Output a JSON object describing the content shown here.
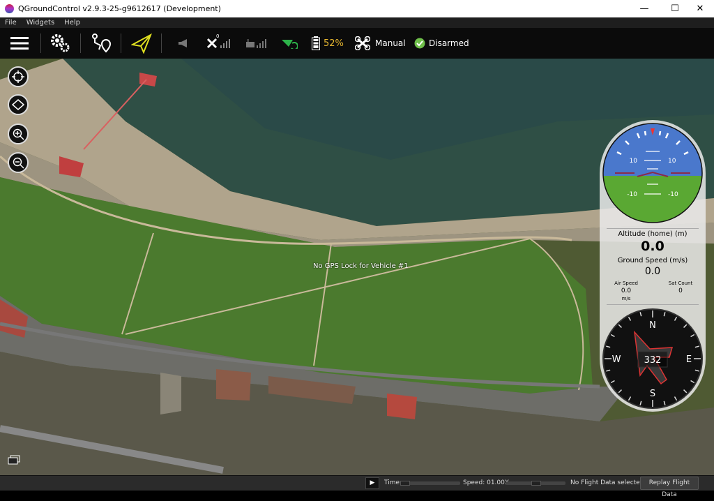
{
  "window": {
    "title": "QGroundControl v2.9.3-25-g9612617 (Development)",
    "minimize": "—",
    "maximize": "☐",
    "close": "✕"
  },
  "menu": [
    "File",
    "Widgets",
    "Help"
  ],
  "toolbar": {
    "battery": "52%",
    "flight_mode": "Manual",
    "arm_status": "Disarmed",
    "gps_sat_count": "0",
    "colors": {
      "battery": "#e8b830",
      "plan_active": "#e0e020",
      "rc_ok": "#2db34a"
    }
  },
  "map": {
    "message": "No GPS Lock for Vehicle #1"
  },
  "instruments": {
    "pitch_labels": [
      "10",
      "10",
      "-10",
      "-10"
    ],
    "altitude_label": "Altitude (home) (m)",
    "altitude": "0.0",
    "ground_speed_label": "Ground Speed (m/s)",
    "ground_speed": "0.0",
    "air_speed_label": "Air Speed",
    "air_speed": "0.0",
    "air_speed_unit": "m/s",
    "sat_count_label": "Sat Count",
    "sat_count": "0",
    "heading": "332",
    "compass": {
      "n": "N",
      "e": "E",
      "s": "S",
      "w": "W"
    }
  },
  "bottom": {
    "time_label": "Time",
    "speed_label": "Speed: 01.00X",
    "status": "No Flight Data selected..",
    "replay_button": "Replay Flight Data"
  }
}
